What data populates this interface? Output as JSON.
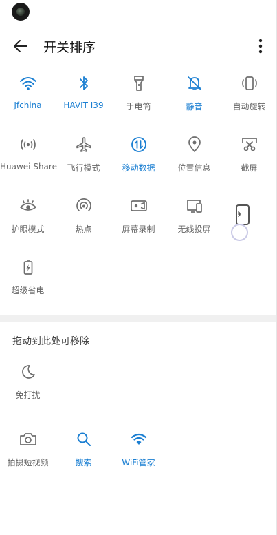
{
  "header": {
    "title": "开关排序"
  },
  "tiles": [
    {
      "label": "Jfchina",
      "icon": "wifi-icon",
      "active": true
    },
    {
      "label": "HAVIT I39",
      "icon": "bluetooth-icon",
      "active": true
    },
    {
      "label": "手电筒",
      "icon": "flashlight-icon",
      "active": false
    },
    {
      "label": "静音",
      "icon": "bell-off-icon",
      "active": true
    },
    {
      "label": "自动旋转",
      "icon": "auto-rotate-icon",
      "active": false
    },
    {
      "label": "Huawei Share",
      "icon": "huawei-share-icon",
      "active": false
    },
    {
      "label": "飞行模式",
      "icon": "airplane-icon",
      "active": false
    },
    {
      "label": "移动数据",
      "icon": "mobile-data-icon",
      "active": true
    },
    {
      "label": "位置信息",
      "icon": "location-icon",
      "active": false
    },
    {
      "label": "截屏",
      "icon": "screenshot-icon",
      "active": false
    },
    {
      "label": "护眼模式",
      "icon": "eye-comfort-icon",
      "active": false
    },
    {
      "label": "热点",
      "icon": "hotspot-icon",
      "active": false
    },
    {
      "label": "屏幕录制",
      "icon": "screen-record-icon",
      "active": false
    },
    {
      "label": "无线投屏",
      "icon": "wireless-projection-icon",
      "active": false
    },
    {
      "label": "超级省电",
      "icon": "ultra-power-saving-icon",
      "active": false
    }
  ],
  "removable_section": {
    "title": "拖动到此处可移除",
    "tiles": [
      {
        "label": "免打扰",
        "icon": "moon-icon",
        "active": false
      },
      {
        "label": "拍摄短视频",
        "icon": "camera-icon",
        "active": false
      },
      {
        "label": "搜索",
        "icon": "search-icon",
        "active": true
      },
      {
        "label": "WiFi管家",
        "icon": "wifi-manager-icon",
        "active": true
      }
    ]
  },
  "colors": {
    "active": "#1b7fd2",
    "inactive_icon": "#6e6e6e",
    "inactive_label": "#666666",
    "divider": "#f0f0f0"
  }
}
